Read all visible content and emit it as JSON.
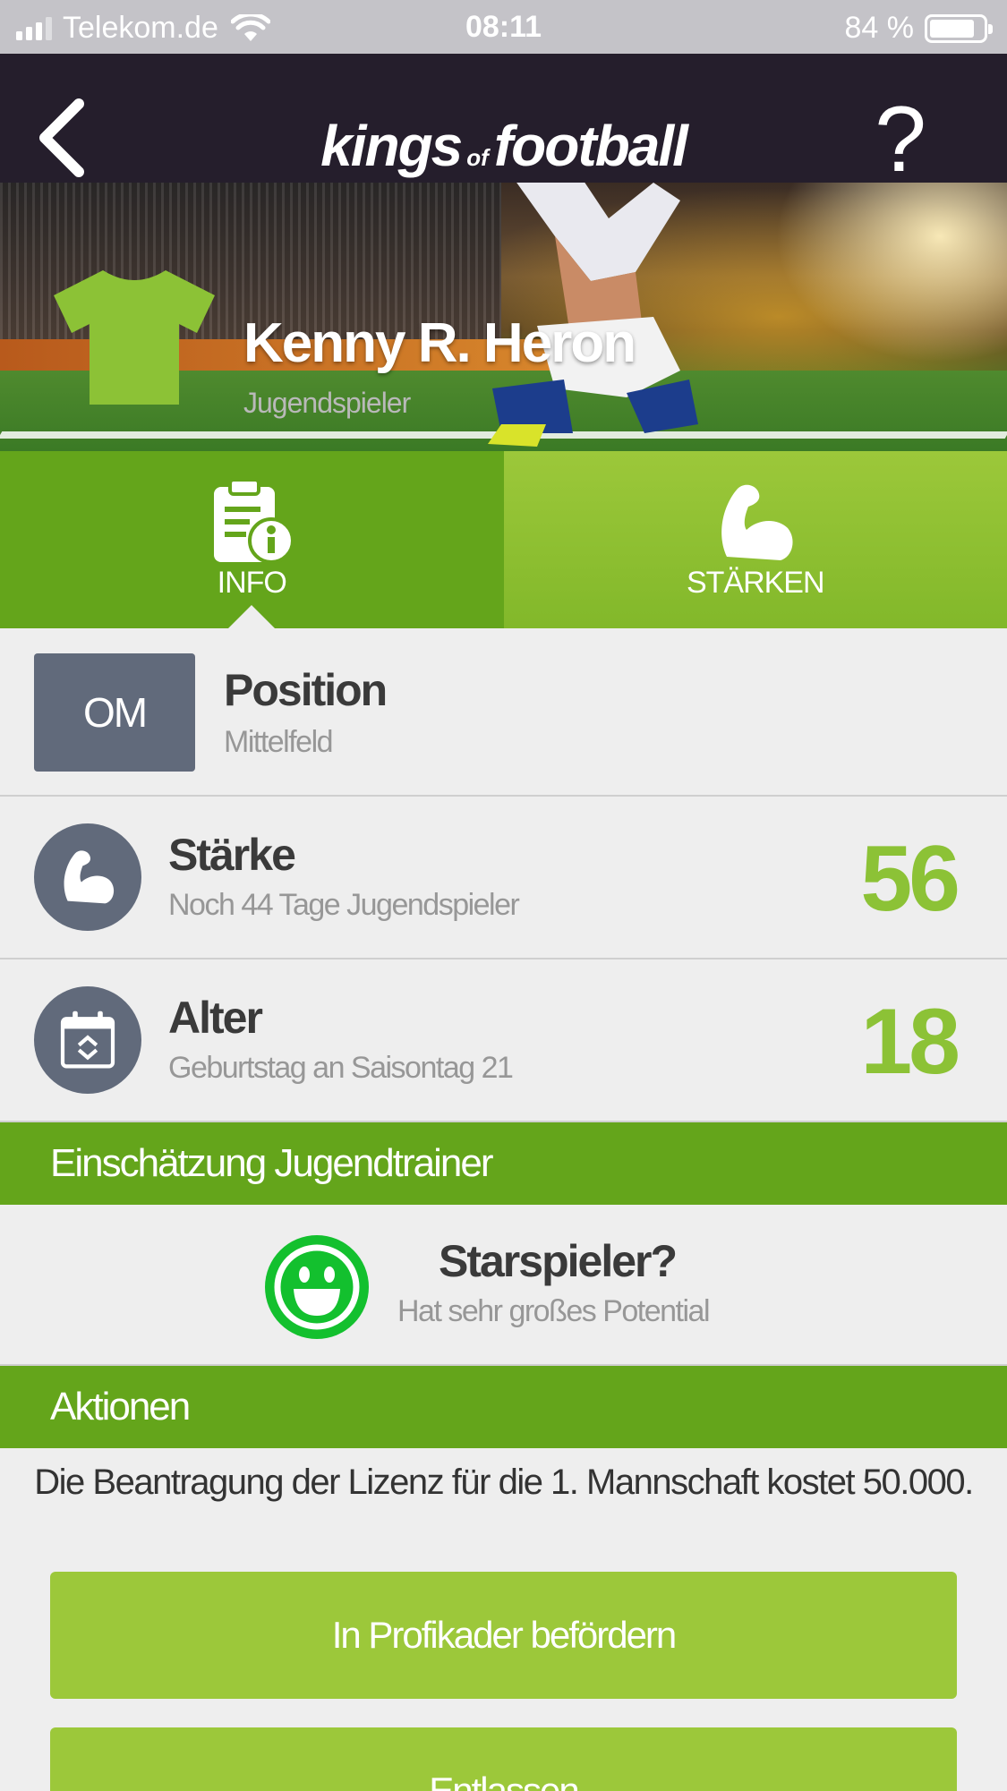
{
  "status_bar": {
    "carrier": "Telekom.de",
    "time": "08:11",
    "battery_percent": "84 %",
    "battery_level": 0.84,
    "signal_bars": 3,
    "icons": [
      "signal-icon",
      "wifi-icon",
      "battery-icon"
    ]
  },
  "nav": {
    "logo_part1": "kings",
    "logo_part2": "of",
    "logo_part3": "football",
    "help_label": "?",
    "back_icon": "chevron-left-icon"
  },
  "player": {
    "name": "Kenny R. Heron",
    "type": "Jugendspieler",
    "jersey_color": "#8cc236",
    "jersey_icon": "jersey-icon"
  },
  "tabs": [
    {
      "label": "INFO",
      "icon": "clipboard-info-icon",
      "active": true
    },
    {
      "label": "STÄRKEN",
      "icon": "flexed-arm-icon",
      "active": false
    }
  ],
  "info": {
    "position": {
      "badge": "OM",
      "title": "Position",
      "subtitle": "Mittelfeld"
    },
    "staerke": {
      "title": "Stärke",
      "subtitle": "Noch 44 Tage Jugendspieler",
      "value": "56",
      "icon": "flexed-arm-icon"
    },
    "alter": {
      "title": "Alter",
      "subtitle": "Geburtstag an Saisontag 21",
      "value": "18",
      "icon": "calendar-icon"
    }
  },
  "sections": {
    "jugendtrainer": "Einschätzung Jugendtrainer",
    "aktionen": "Aktionen"
  },
  "assessment": {
    "title": "Starspieler?",
    "subtitle": "Hat sehr großes Potential",
    "icon": "smiley-icon",
    "color": "#13c02e"
  },
  "actions": {
    "text": "Die Beantragung der Lizenz für die 1. Mannschaft kostet 50.000.",
    "promote_label": "In Profikader befördern",
    "dismiss_label": "Entlassen"
  },
  "colors": {
    "nav_bg": "#251e2c",
    "green_dark": "#64a51b",
    "green_light": "#9cc83a",
    "value_green": "#8cc236",
    "icon_gray": "#616a7b"
  }
}
